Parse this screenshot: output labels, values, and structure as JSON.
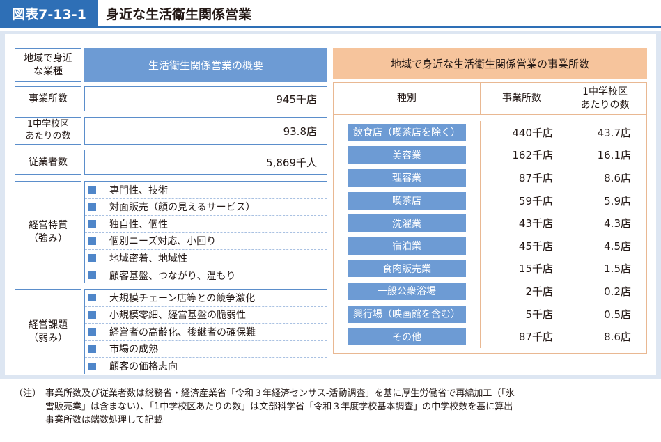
{
  "header": {
    "figure_label": "図表7-13-1",
    "title": "身近な生活衛生関係営業"
  },
  "left": {
    "corner_label": "地域で身近\nな業種",
    "overview_heading": "生活衛生関係営業の概要",
    "rows": [
      {
        "label": "事業所数",
        "value": "945千店"
      },
      {
        "label": "1中学校区\nあたりの数",
        "value": "93.8店"
      },
      {
        "label": "従業者数",
        "value": "5,869千人"
      }
    ],
    "strengths": {
      "label": "経営特質\n（強み）",
      "items": [
        "専門性、技術",
        "対面販売（顔の見えるサービス）",
        "独自性、個性",
        "個別ニーズ対応、小回り",
        "地域密着、地域性",
        "顧客基盤、つながり、温もり"
      ]
    },
    "issues": {
      "label": "経営課題\n（弱み）",
      "items": [
        "大規模チェーン店等との競争激化",
        "小規模零細、経営基盤の脆弱性",
        "経営者の高齢化、後継者の確保難",
        "市場の成熟",
        "顧客の価格志向"
      ]
    }
  },
  "right": {
    "heading": "地域で身近な生活衛生関係営業の事業所数",
    "columns": [
      "種別",
      "事業所数",
      "1中学校区\nあたりの数"
    ],
    "rows": [
      {
        "category": "飲食店（喫茶店を除く）",
        "count": "440千店",
        "per_district": "43.7店"
      },
      {
        "category": "美容業",
        "count": "162千店",
        "per_district": "16.1店"
      },
      {
        "category": "理容業",
        "count": "87千店",
        "per_district": "8.6店"
      },
      {
        "category": "喫茶店",
        "count": "59千店",
        "per_district": "5.9店"
      },
      {
        "category": "洗濯業",
        "count": "43千店",
        "per_district": "4.3店"
      },
      {
        "category": "宿泊業",
        "count": "45千店",
        "per_district": "4.5店"
      },
      {
        "category": "食肉販売業",
        "count": "15千店",
        "per_district": "1.5店"
      },
      {
        "category": "一般公衆浴場",
        "count": "2千店",
        "per_district": "0.2店"
      },
      {
        "category": "興行場（映画館を含む）",
        "count": "5千店",
        "per_district": "0.5店"
      },
      {
        "category": "その他",
        "count": "87千店",
        "per_district": "8.6店"
      }
    ]
  },
  "note": {
    "label": "（注）",
    "lines": [
      "事業所数及び従業者数は総務省・経済産業省「令和３年経済センサス‐活動調査」を基に厚生労働省で再編加工（「氷",
      "雪販売業」は含まない）、「1中学校区あたりの数」は文部科学省「令和３年度学校基本調査」の中学校数を基に算出",
      "事業所数は端数処理して記載"
    ]
  },
  "colors": {
    "brand_blue": "#2e6fb6",
    "category_blue": "#6d9bd4",
    "orange_heading": "#f6c49c"
  }
}
